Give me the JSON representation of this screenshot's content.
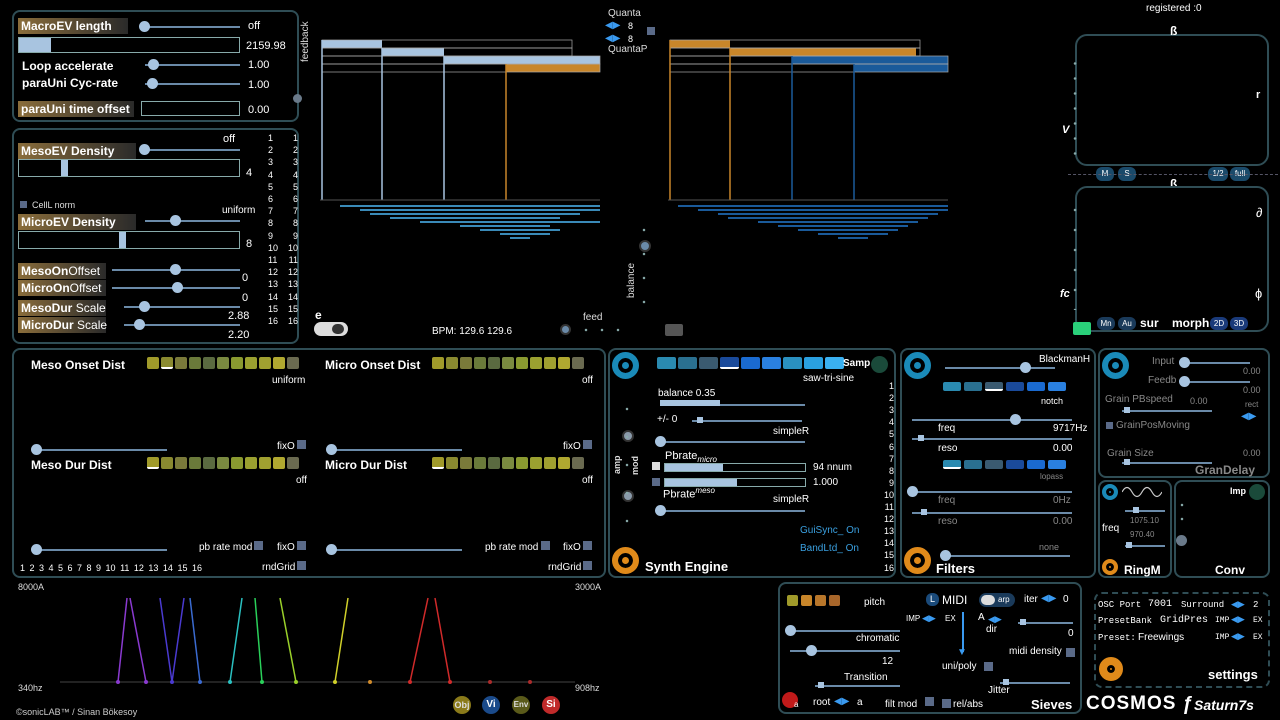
{
  "macro": {
    "length_label": "MacroEV length",
    "length_value": "off",
    "length_bar_value": "2159.98",
    "loop_label": "Loop accelerate",
    "loop_value": "1.00",
    "cycrate_label": "paraUni  Cyc-rate",
    "cycrate_value": "1.00",
    "timeoffset_label": "paraUni time offset",
    "timeoffset_value": "0.00",
    "feedback_label": "feedback"
  },
  "meso": {
    "off_label": "off",
    "meso_density_label": "MesoEV  Density",
    "meso_density_value": "4",
    "celll_label": "CellL norm",
    "uniform_label": "uniform",
    "micro_density_label": "MicroEV  Density",
    "micro_density_value": "8",
    "mesoonoffset_label_a": "MesoOn",
    "mesoonoffset_label_b": "Offset",
    "mesoonoffset_value": "0",
    "microonoffset_label_a": "MicroOn",
    "microonoffset_label_b": "Offset",
    "microonoffset_value": "0",
    "mesodur_label_a": "MesoDur",
    "mesodur_label_b": "Scale",
    "mesodur_value": "2.88",
    "microdur_label_a": "MicroDur",
    "microdur_label_b": "Scale",
    "microdur_value": "2.20",
    "col_a": [
      "1",
      "2",
      "3",
      "4",
      "5",
      "6",
      "7",
      "8",
      "9",
      "10",
      "11",
      "12",
      "13",
      "14",
      "15",
      "16"
    ],
    "col_b": [
      "1",
      "2",
      "3",
      "4",
      "5",
      "6",
      "7",
      "8",
      "9",
      "10",
      "11",
      "12",
      "13",
      "14",
      "15",
      "16"
    ]
  },
  "center": {
    "e_label": "e",
    "bpm": "BPM: 129.6  129.6",
    "feed_label": "feed",
    "balance_label": "balance",
    "quanta_label": "Quanta",
    "quanta_value_1": "8",
    "quanta_value_2": "8",
    "quantap_label": "QuantaP"
  },
  "spatial": {
    "registered": "registered :0",
    "beta_top": "ß",
    "beta_mid": "ß",
    "v_label": "V",
    "r_label": "r",
    "d_label": "∂",
    "fc_label": "fc",
    "phi_label": "ɸ",
    "m_btn": "M",
    "s_btn": "S",
    "half_btn": "1/2",
    "full_btn": "full",
    "mn_btn": "Mn",
    "au_btn": "Au",
    "sur_label": "sur",
    "morph_label": "morph",
    "b2d": "2D",
    "b3d": "3D"
  },
  "dist": {
    "meso_onset": "Meso Onset Dist",
    "meso_onset_value": "uniform",
    "micro_onset": "Micro Onset Dist",
    "micro_onset_value": "off",
    "meso_dur": "Meso Dur  Dist",
    "meso_dur_value": "off",
    "micro_dur": "Micro Dur Dist",
    "micro_dur_value": "off",
    "fixo_1": "fixO",
    "fixo_2": "fixO",
    "fixo_3": "fixO",
    "fixo_4": "fixO",
    "pbrate_1": "pb rate mod",
    "pbrate_2": "pb rate mod",
    "rndgrid_1": "rndGrid",
    "rndgrid_2": "rndGrid",
    "numbers": "1  2  3  4  5  6  7  8  9  10 11 12 13 14 15 16",
    "palette": [
      "#a09a2a",
      "#8a8a30",
      "#7a7a3a",
      "#6a7a3a",
      "#5a6a40",
      "#7a8a40",
      "#8a9a30",
      "#9aa030",
      "#a0a030",
      "#b0a830",
      "#6a6a50"
    ]
  },
  "synth": {
    "title": "Synth Engine",
    "samp_label": "Samp",
    "wave_label": "saw-tri-sine",
    "balance_label": "balance 0.35",
    "pm_label": "+/- 0",
    "simpler_1": "simpleR",
    "pbrate_micro_label": "Pbrate",
    "pbrate_micro_sub": "micro",
    "pbrate_micro_value": "94 nnum",
    "pbrate_meso_value": "1.000",
    "pbrate_meso_label": "Pbrate",
    "pbrate_meso_sub": "meso",
    "simpler_2": "simpleR",
    "guisync": "GuiSync_ On",
    "bandltd": "BandLtd_ On",
    "amp_label": "amp",
    "mod_label": "mod",
    "channels": [
      "1",
      "2",
      "3",
      "4",
      "5",
      "6",
      "7",
      "8",
      "9",
      "10",
      "11",
      "12",
      "13",
      "14",
      "15",
      "16"
    ],
    "palette": [
      "#2a8ab0",
      "#2a7090",
      "#3a5a70",
      "#1a4a9a",
      "#1a6ad0",
      "#2a80e0",
      "#2a90c0",
      "#2aa0e0",
      "#3ab0f0"
    ]
  },
  "filters": {
    "title": "Filters",
    "window_label": "BlackmanH",
    "notch_label": "notch",
    "freq_label": "freq",
    "freq_value": "9717Hz",
    "reso_label": "reso",
    "reso_value": "0.00",
    "lopass_label": "lopass",
    "freq2_label": "freq",
    "freq2_value": "0Hz",
    "reso2_label": "reso",
    "reso2_value": "0.00",
    "none_label": "none"
  },
  "grandelay": {
    "title": "GranDelay",
    "input_label": "Input",
    "input_value": "0.00",
    "feedb_label": "Feedb",
    "feedb_value": "0.00",
    "pbspeed_label": "Grain PBspeed",
    "pbspeed_value": "0.00",
    "rect_label": "rect",
    "posmoving_label": "GrainPosMoving",
    "size_label": "Grain Size",
    "size_value": "0.00"
  },
  "ringm": {
    "title": "RingM",
    "freq_label": "freq",
    "v1": "1075.10",
    "v2": "970.40"
  },
  "conv": {
    "title": "Conv",
    "imp_label": "Imp"
  },
  "sieves": {
    "title": "Sieves",
    "pitch_label": "pitch",
    "chromatic_label": "chromatic",
    "chromatic_value": "12",
    "transition_label": "Transition",
    "root_label": "root",
    "root_value": "a",
    "a_label": "a",
    "filtmod_label": "filt mod",
    "relabs_label": "rel/abs",
    "l_label": "L",
    "midi_label": "MIDI",
    "arp_label": "arp",
    "iter_label": "iter",
    "iter_value": "0",
    "imp_label": "IMP",
    "ex_label": "EX",
    "a_dir_label": "A",
    "dir_label": "dir",
    "dir_value": "0",
    "midi_density_label": "midi density",
    "unipoly_label": "uni/poly",
    "jitter_label": "Jitter"
  },
  "settings": {
    "title": "settings",
    "osc_label": "OSC Port",
    "osc_value": "7001",
    "surround_label": "Surround",
    "surround_value": "2",
    "presetbank_label": "PresetBank",
    "presetbank_value": "GridPres",
    "preset_label": "Preset:",
    "preset_value": "Freewings",
    "imp_1": "IMP",
    "ex_1": "EX",
    "imp_2": "IMP",
    "ex_2": "EX"
  },
  "brand": {
    "cosmos": "COSMOS",
    "f": "ƒ",
    "saturn": "Saturn7s",
    "credit": "©sonicLAB™ / Sinan Bökesoy"
  },
  "spectrum": {
    "hz_top_left": "8000A",
    "hz_top_right": "3000A",
    "hz_bottom_left": "340hz",
    "hz_bottom_right": "908hz"
  },
  "bottom_buttons": {
    "obj": "Obj",
    "vi": "Vi",
    "env": "Env",
    "si": "Si"
  }
}
